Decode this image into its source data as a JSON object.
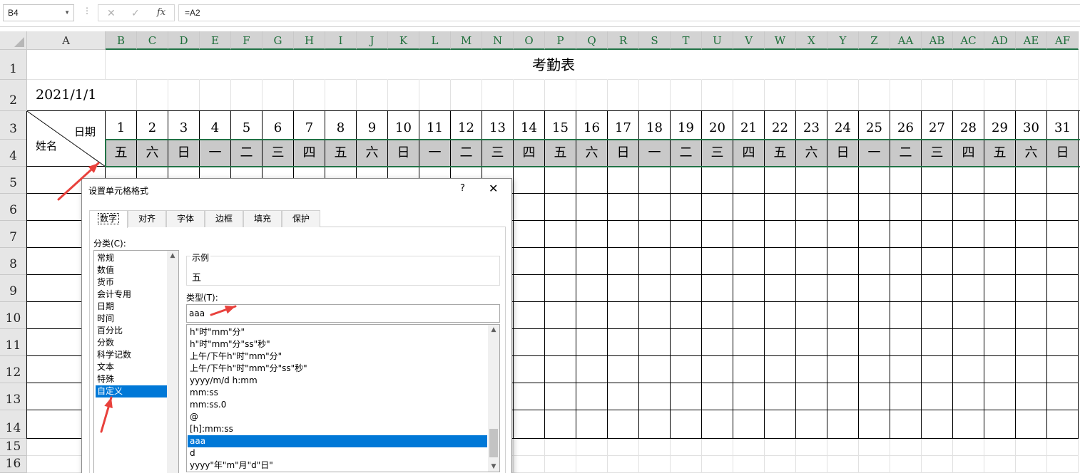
{
  "formula_bar": {
    "name_box": "B4",
    "formula": "=A2",
    "cancel_icon": "✕",
    "enter_icon": "✓",
    "fx_label": "fx"
  },
  "columns": [
    "A",
    "B",
    "C",
    "D",
    "E",
    "F",
    "G",
    "H",
    "I",
    "J",
    "K",
    "L",
    "M",
    "N",
    "O",
    "P",
    "Q",
    "R",
    "S",
    "T",
    "U",
    "V",
    "W",
    "X",
    "Y",
    "Z",
    "AA",
    "AB",
    "AC",
    "AD",
    "AE",
    "AF"
  ],
  "rows": [
    "1",
    "2",
    "3",
    "4",
    "5",
    "6",
    "7",
    "8",
    "9",
    "10",
    "11",
    "12",
    "13",
    "14",
    "15",
    "16"
  ],
  "sheet": {
    "title": "考勤表",
    "date": "2021/1/1",
    "header_date_label": "日期",
    "header_name_label": "姓名",
    "days": [
      "1",
      "2",
      "3",
      "4",
      "5",
      "6",
      "7",
      "8",
      "9",
      "10",
      "11",
      "12",
      "13",
      "14",
      "15",
      "16",
      "17",
      "18",
      "19",
      "20",
      "21",
      "22",
      "23",
      "24",
      "25",
      "26",
      "27",
      "28",
      "29",
      "30",
      "31"
    ],
    "weekdays": [
      "五",
      "六",
      "日",
      "一",
      "二",
      "三",
      "四",
      "五",
      "六",
      "日",
      "一",
      "二",
      "三",
      "四",
      "五",
      "六",
      "日",
      "一",
      "二",
      "三",
      "四",
      "五",
      "六",
      "日",
      "一",
      "二",
      "三",
      "四",
      "五",
      "六",
      "日"
    ]
  },
  "dialog": {
    "title": "设置单元格格式",
    "help": "?",
    "close": "✕",
    "tabs": [
      "数字",
      "对齐",
      "字体",
      "边框",
      "填充",
      "保护"
    ],
    "active_tab": "数字",
    "category_label": "分类(C):",
    "categories": [
      "常规",
      "数值",
      "货币",
      "会计专用",
      "日期",
      "时间",
      "百分比",
      "分数",
      "科学记数",
      "文本",
      "特殊",
      "自定义"
    ],
    "selected_category": "自定义",
    "sample_label": "示例",
    "sample_value": "五",
    "type_label": "类型(T):",
    "type_value": "aaa",
    "formats": [
      "h\"时\"mm\"分\"",
      "h\"时\"mm\"分\"ss\"秒\"",
      "上午/下午h\"时\"mm\"分\"",
      "上午/下午h\"时\"mm\"分\"ss\"秒\"",
      "yyyy/m/d h:mm",
      "mm:ss",
      "mm:ss.0",
      "@",
      "[h]:mm:ss",
      "aaa",
      "d",
      "yyyy\"年\"m\"月\"d\"日\""
    ],
    "selected_format": "aaa"
  },
  "colors": {
    "selection_green": "#217346",
    "weekday_fill": "#c9c9c9",
    "list_highlight": "#0078d7",
    "arrow_red": "#e8413c"
  }
}
